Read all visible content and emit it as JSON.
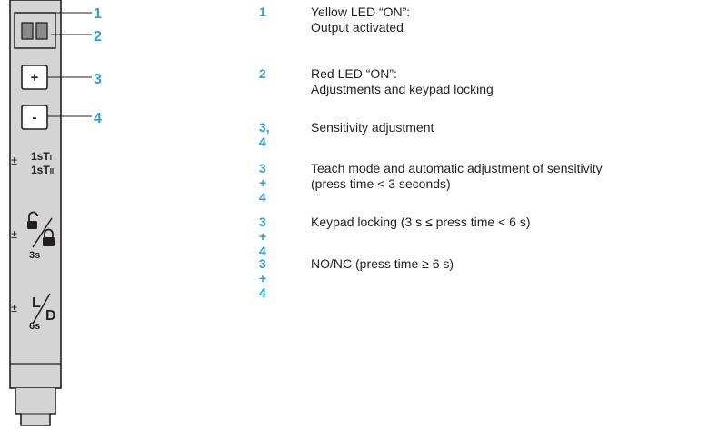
{
  "callouts": [
    "1",
    "2",
    "3",
    "4"
  ],
  "device": {
    "plus_button": "+",
    "minus_button": "-",
    "pm_symbol": "±",
    "teach_top": "1sT",
    "teach_top_sub": "I",
    "teach_bottom": "1sT",
    "teach_bottom_sub": "II",
    "lock_time": "3s",
    "ld_L": "L",
    "ld_D": "D",
    "ld_time": "6s"
  },
  "colors": {
    "accent": "#2e9ed8",
    "housing": "#d4d4d4",
    "led": "#8a8a8a",
    "text": "#231f20"
  },
  "legend": [
    {
      "num": "1",
      "line1": "Yellow LED “ON”:",
      "line2": "Output activated"
    },
    {
      "num": "2",
      "line1": "Red LED “ON”:",
      "line2": "Adjustments and keypad locking"
    },
    {
      "num": "3, 4",
      "line1": "Sensitivity adjustment"
    },
    {
      "num": "3 + 4",
      "line1": "Teach mode and automatic adjustment of sensitivity",
      "line2": "(press time < 3 seconds)"
    },
    {
      "num": "3 + 4",
      "line1": "Keypad locking (3 s ≤ press time < 6 s)"
    },
    {
      "num": "3 + 4",
      "line1": "NO/NC (press time ≥ 6 s)"
    }
  ]
}
